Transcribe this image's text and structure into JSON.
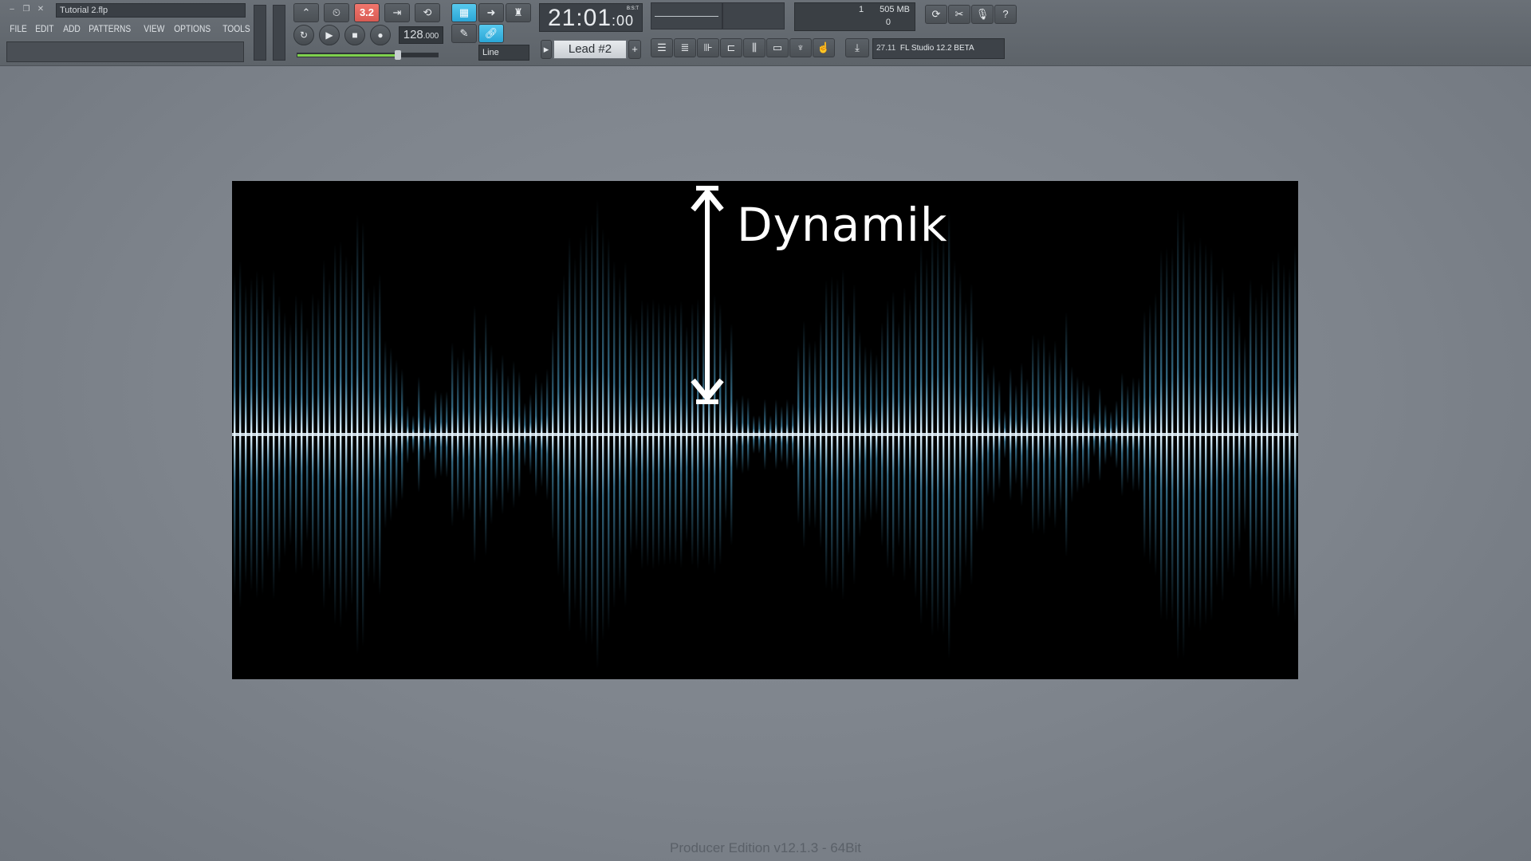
{
  "window": {
    "title": "Tutorial 2.flp",
    "min_glyph": "–",
    "restore_glyph": "❐",
    "close_glyph": "✕"
  },
  "menu": [
    "FILE",
    "EDIT",
    "ADD",
    "PATTERNS",
    "VIEW",
    "OPTIONS",
    "TOOLS",
    "?"
  ],
  "transport": {
    "tempo_int": "128",
    "tempo_dec": ".000",
    "record_countdown_label": "3.2",
    "snap_label": "Line"
  },
  "clock": {
    "main": "21:01",
    "sub": ":00",
    "tag": "B:S:T"
  },
  "pattern": {
    "name": "Lead #2"
  },
  "memory": {
    "value": "505 MB",
    "cpu": "1",
    "poly": "0"
  },
  "hint": {
    "version": "27.11",
    "text": "FL Studio 12.2 BETA"
  },
  "waveform": {
    "label": "Dynamik",
    "color": "#5ab8e6",
    "glow": "#e8f6ff"
  },
  "footer": "Producer Edition v12.1.3 - 64Bit"
}
